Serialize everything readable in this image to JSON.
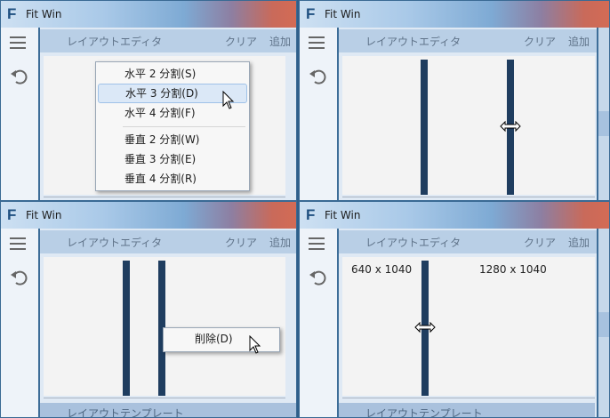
{
  "app": {
    "title": "Fit Win",
    "logo_letter": "F"
  },
  "toolbar": {
    "title": "レイアウトエディタ",
    "clear": "クリア",
    "add": "追加"
  },
  "template_header": "レイアウトテンプレート",
  "icons": {
    "menu": "hamburger-icon",
    "undo": "undo-icon",
    "resize_cursor": "resize-horizontal-cursor-icon",
    "pointer": "mouse-pointer-icon"
  },
  "colors": {
    "divider": "#1f3d5f",
    "toolbar": "#b9cfe6",
    "selection": "#dbe8f7"
  },
  "context_menu": {
    "horizontal": [
      {
        "label": "水平 2 分割(S)"
      },
      {
        "label": "水平 3 分割(D)",
        "selected": true
      },
      {
        "label": "水平 4 分割(F)"
      }
    ],
    "vertical": [
      {
        "label": "垂直 2 分割(W)"
      },
      {
        "label": "垂直 3 分割(E)"
      },
      {
        "label": "垂直 4 分割(R)"
      }
    ]
  },
  "divider_menu": {
    "delete": "削除(D)"
  },
  "resolutions": {
    "left": "640 x 1040",
    "right": "1280 x 1040"
  }
}
